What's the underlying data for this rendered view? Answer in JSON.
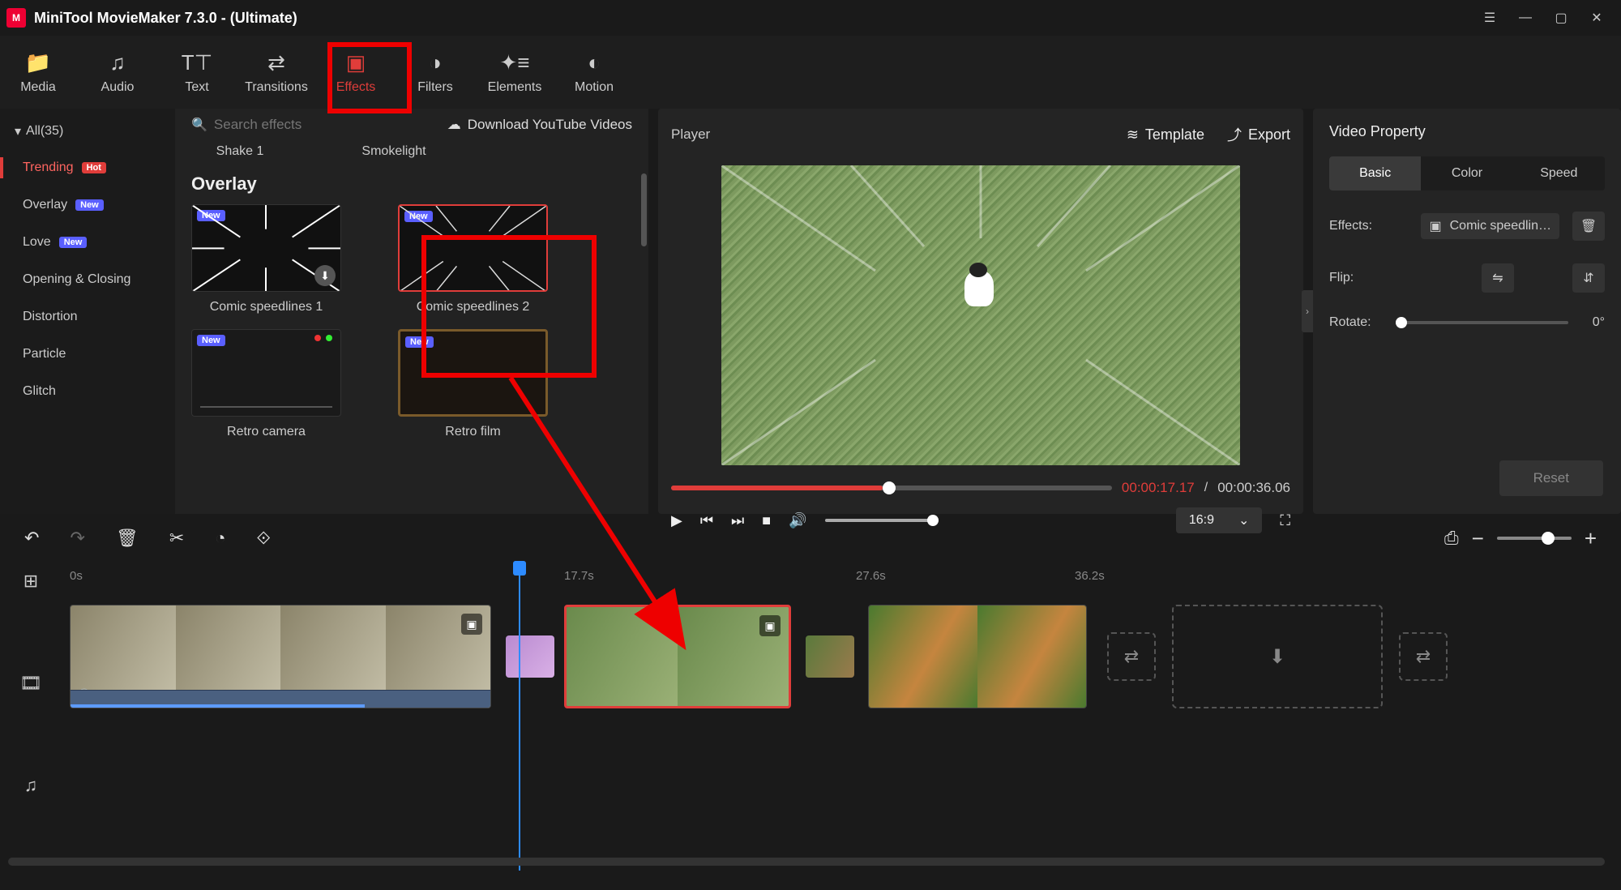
{
  "app": {
    "title": "MiniTool MovieMaker 7.3.0 - (Ultimate)"
  },
  "tabs": {
    "media": "Media",
    "audio": "Audio",
    "text": "Text",
    "transitions": "Transitions",
    "effects": "Effects",
    "filters": "Filters",
    "elements": "Elements",
    "motion": "Motion"
  },
  "browser": {
    "all_label": "All(35)",
    "cats": {
      "trending": "Trending",
      "overlay": "Overlay",
      "love": "Love",
      "opening": "Opening & Closing",
      "distortion": "Distortion",
      "particle": "Particle",
      "glitch": "Glitch"
    },
    "badges": {
      "hot": "Hot",
      "new": "New"
    },
    "search_placeholder": "Search effects",
    "dl_label": "Download YouTube Videos",
    "row0": {
      "shake": "Shake 1",
      "smoke": "Smokelight"
    },
    "section": "Overlay",
    "fx": {
      "c1": "Comic speedlines 1",
      "c2": "Comic speedlines 2",
      "rc": "Retro camera",
      "rf": "Retro film"
    }
  },
  "player": {
    "label": "Player",
    "template": "Template",
    "export": "Export",
    "current": "00:00:17.17",
    "total": "00:00:36.06",
    "aspect": "16:9"
  },
  "props": {
    "title": "Video Property",
    "tabs": {
      "basic": "Basic",
      "color": "Color",
      "speed": "Speed"
    },
    "effects_label": "Effects:",
    "effect_name": "Comic speedlin…",
    "flip_label": "Flip:",
    "rotate_label": "Rotate:",
    "rotate_val": "0°",
    "reset": "Reset"
  },
  "ruler": {
    "t0": "0s",
    "t1": "17.7s",
    "t2": "27.6s",
    "t3": "36.2s"
  }
}
